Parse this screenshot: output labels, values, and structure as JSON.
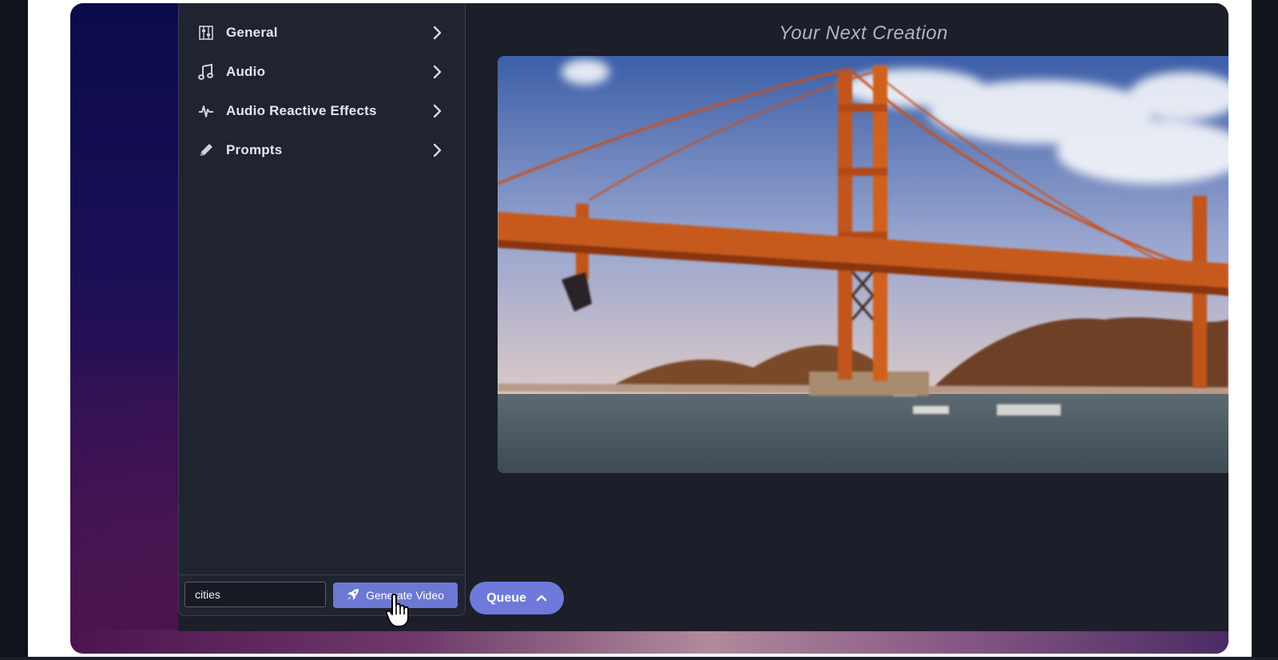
{
  "sidebar": {
    "items": [
      {
        "label": "General",
        "icon": "sliders-icon"
      },
      {
        "label": "Audio",
        "icon": "music-note-icon"
      },
      {
        "label": "Audio Reactive Effects",
        "icon": "waveform-icon"
      },
      {
        "label": "Prompts",
        "icon": "pencil-icon"
      }
    ]
  },
  "preview": {
    "title": "Your Next Creation",
    "image": "golden-gate-bridge"
  },
  "controls": {
    "prompt_value": "cities",
    "generate_label": "Generate Video",
    "generate_icon": "rocket-icon",
    "queue_label": "Queue",
    "queue_icon": "chevron-up-icon"
  },
  "colors": {
    "accent": "#6c78d4",
    "panel": "#1c1f29",
    "sidebar": "#202430"
  }
}
